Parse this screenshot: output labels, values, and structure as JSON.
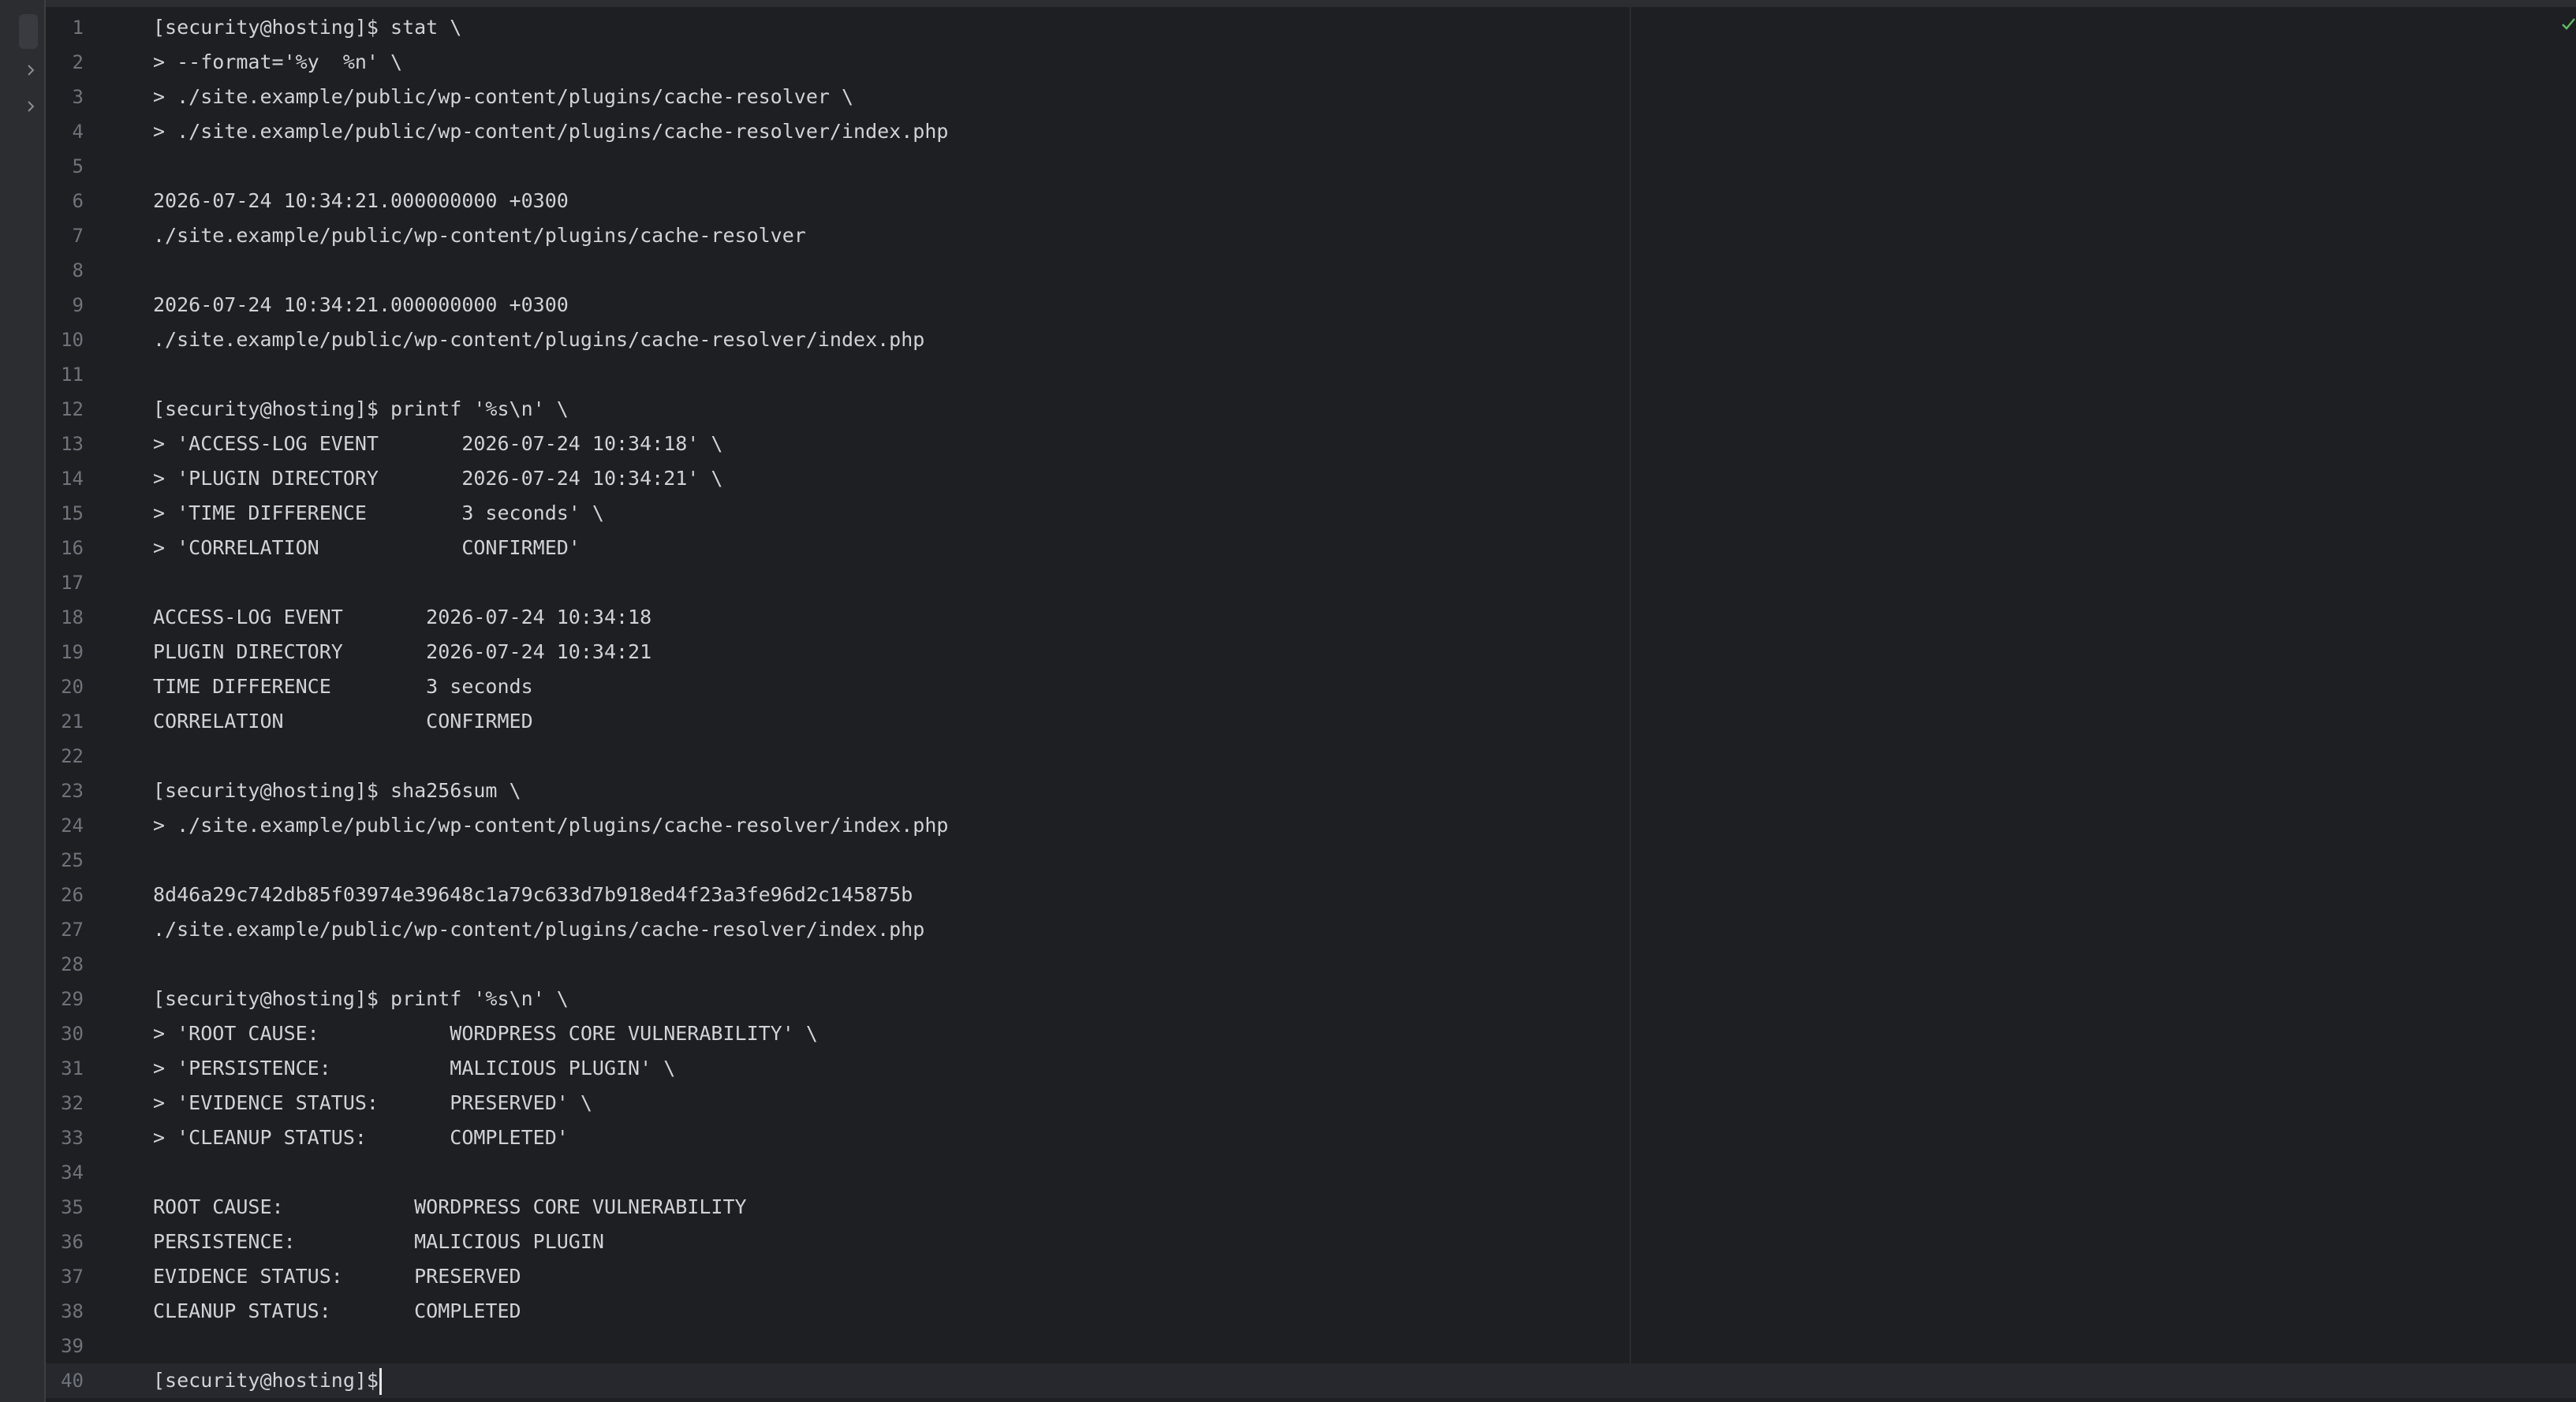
{
  "editor": {
    "prompt": "[security@hosting]$",
    "current_line": 40,
    "lines": [
      {
        "n": "1",
        "t": "[security@hosting]$ stat \\"
      },
      {
        "n": "2",
        "t": "> --format='%y  %n' \\"
      },
      {
        "n": "3",
        "t": "> ./site.example/public/wp-content/plugins/cache-resolver \\"
      },
      {
        "n": "4",
        "t": "> ./site.example/public/wp-content/plugins/cache-resolver/index.php"
      },
      {
        "n": "5",
        "t": ""
      },
      {
        "n": "6",
        "t": "2026-07-24 10:34:21.000000000 +0300"
      },
      {
        "n": "7",
        "t": "./site.example/public/wp-content/plugins/cache-resolver"
      },
      {
        "n": "8",
        "t": ""
      },
      {
        "n": "9",
        "t": "2026-07-24 10:34:21.000000000 +0300"
      },
      {
        "n": "10",
        "t": "./site.example/public/wp-content/plugins/cache-resolver/index.php"
      },
      {
        "n": "11",
        "t": ""
      },
      {
        "n": "12",
        "t": "[security@hosting]$ printf '%s\\n' \\"
      },
      {
        "n": "13",
        "t": "> 'ACCESS-LOG EVENT       2026-07-24 10:34:18' \\"
      },
      {
        "n": "14",
        "t": "> 'PLUGIN DIRECTORY       2026-07-24 10:34:21' \\"
      },
      {
        "n": "15",
        "t": "> 'TIME DIFFERENCE        3 seconds' \\"
      },
      {
        "n": "16",
        "t": "> 'CORRELATION            CONFIRMED'"
      },
      {
        "n": "17",
        "t": ""
      },
      {
        "n": "18",
        "t": "ACCESS-LOG EVENT       2026-07-24 10:34:18"
      },
      {
        "n": "19",
        "t": "PLUGIN DIRECTORY       2026-07-24 10:34:21"
      },
      {
        "n": "20",
        "t": "TIME DIFFERENCE        3 seconds"
      },
      {
        "n": "21",
        "t": "CORRELATION            CONFIRMED"
      },
      {
        "n": "22",
        "t": ""
      },
      {
        "n": "23",
        "t": "[security@hosting]$ sha256sum \\"
      },
      {
        "n": "24",
        "t": "> ./site.example/public/wp-content/plugins/cache-resolver/index.php"
      },
      {
        "n": "25",
        "t": ""
      },
      {
        "n": "26",
        "t": "8d46a29c742db85f03974e39648c1a79c633d7b918ed4f23a3fe96d2c145875b"
      },
      {
        "n": "27",
        "t": "./site.example/public/wp-content/plugins/cache-resolver/index.php"
      },
      {
        "n": "28",
        "t": ""
      },
      {
        "n": "29",
        "t": "[security@hosting]$ printf '%s\\n' \\"
      },
      {
        "n": "30",
        "t": "> 'ROOT CAUSE:           WORDPRESS CORE VULNERABILITY' \\"
      },
      {
        "n": "31",
        "t": "> 'PERSISTENCE:          MALICIOUS PLUGIN' \\"
      },
      {
        "n": "32",
        "t": "> 'EVIDENCE STATUS:      PRESERVED' \\"
      },
      {
        "n": "33",
        "t": "> 'CLEANUP STATUS:       COMPLETED'"
      },
      {
        "n": "34",
        "t": ""
      },
      {
        "n": "35",
        "t": "ROOT CAUSE:           WORDPRESS CORE VULNERABILITY"
      },
      {
        "n": "36",
        "t": "PERSISTENCE:          MALICIOUS PLUGIN"
      },
      {
        "n": "37",
        "t": "EVIDENCE STATUS:      PRESERVED"
      },
      {
        "n": "38",
        "t": "CLEANUP STATUS:       COMPLETED"
      },
      {
        "n": "39",
        "t": ""
      },
      {
        "n": "40",
        "t": "[security@hosting]$"
      }
    ]
  },
  "icons": {
    "fold_left": "chevron-right-icon",
    "status": "check-icon"
  },
  "colors": {
    "background": "#1e1f22",
    "text": "#d0d2d6",
    "line_number": "#6f737a",
    "check": "#5fb865"
  }
}
